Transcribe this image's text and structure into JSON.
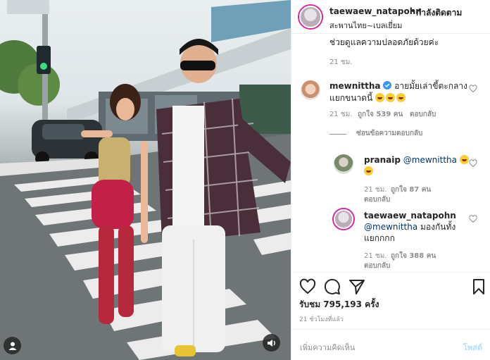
{
  "post": {
    "author": "taewaew_natapohn",
    "dot": "•",
    "follow_status": "กำลังติดตาม",
    "location": "สะพานไทย~เบลเยี่ยม"
  },
  "comments": [
    {
      "text": "ช่วยดูแลความปลอดภัยด้วยค่ะ",
      "time": "21 ชม."
    },
    {
      "user": "mewnittha",
      "text_line1": "อายมั้ยเล่าขี้ตะกลาง",
      "text_line2": "แยกขนาดนี้",
      "time": "21 ชม.",
      "likes": "ถูกใจ 539 คน",
      "reply": "ตอบกลับ",
      "hide_replies": "ซ่อนข้อความตอบกลับ"
    }
  ],
  "replies": [
    {
      "user": "pranaip",
      "mention": "@mewnittha",
      "time": "21 ชม.",
      "likes": "ถูกใจ 87 คน",
      "reply": "ตอบกลับ"
    },
    {
      "user": "taewaew_natapohn",
      "mention": "@mewnittha",
      "text_line1": "มองกันทั้ง",
      "text_line2": "แยกกกก",
      "time": "21 ชม.",
      "likes": "ถูกใจ 388 คน",
      "reply": "ตอบกลับ"
    }
  ],
  "footer": {
    "views": "รับชม 795,193 ครั้ง",
    "posted": "21 ชั่วโมงที่แล้ว",
    "add_comment_placeholder": "เพิ่มความคิดเห็น",
    "post_label": "โพสต์"
  },
  "colors": {
    "mention": "#00376b",
    "verified": "#3897f0",
    "post_disabled": "#b2dffc",
    "meta": "#8e8e8e"
  }
}
